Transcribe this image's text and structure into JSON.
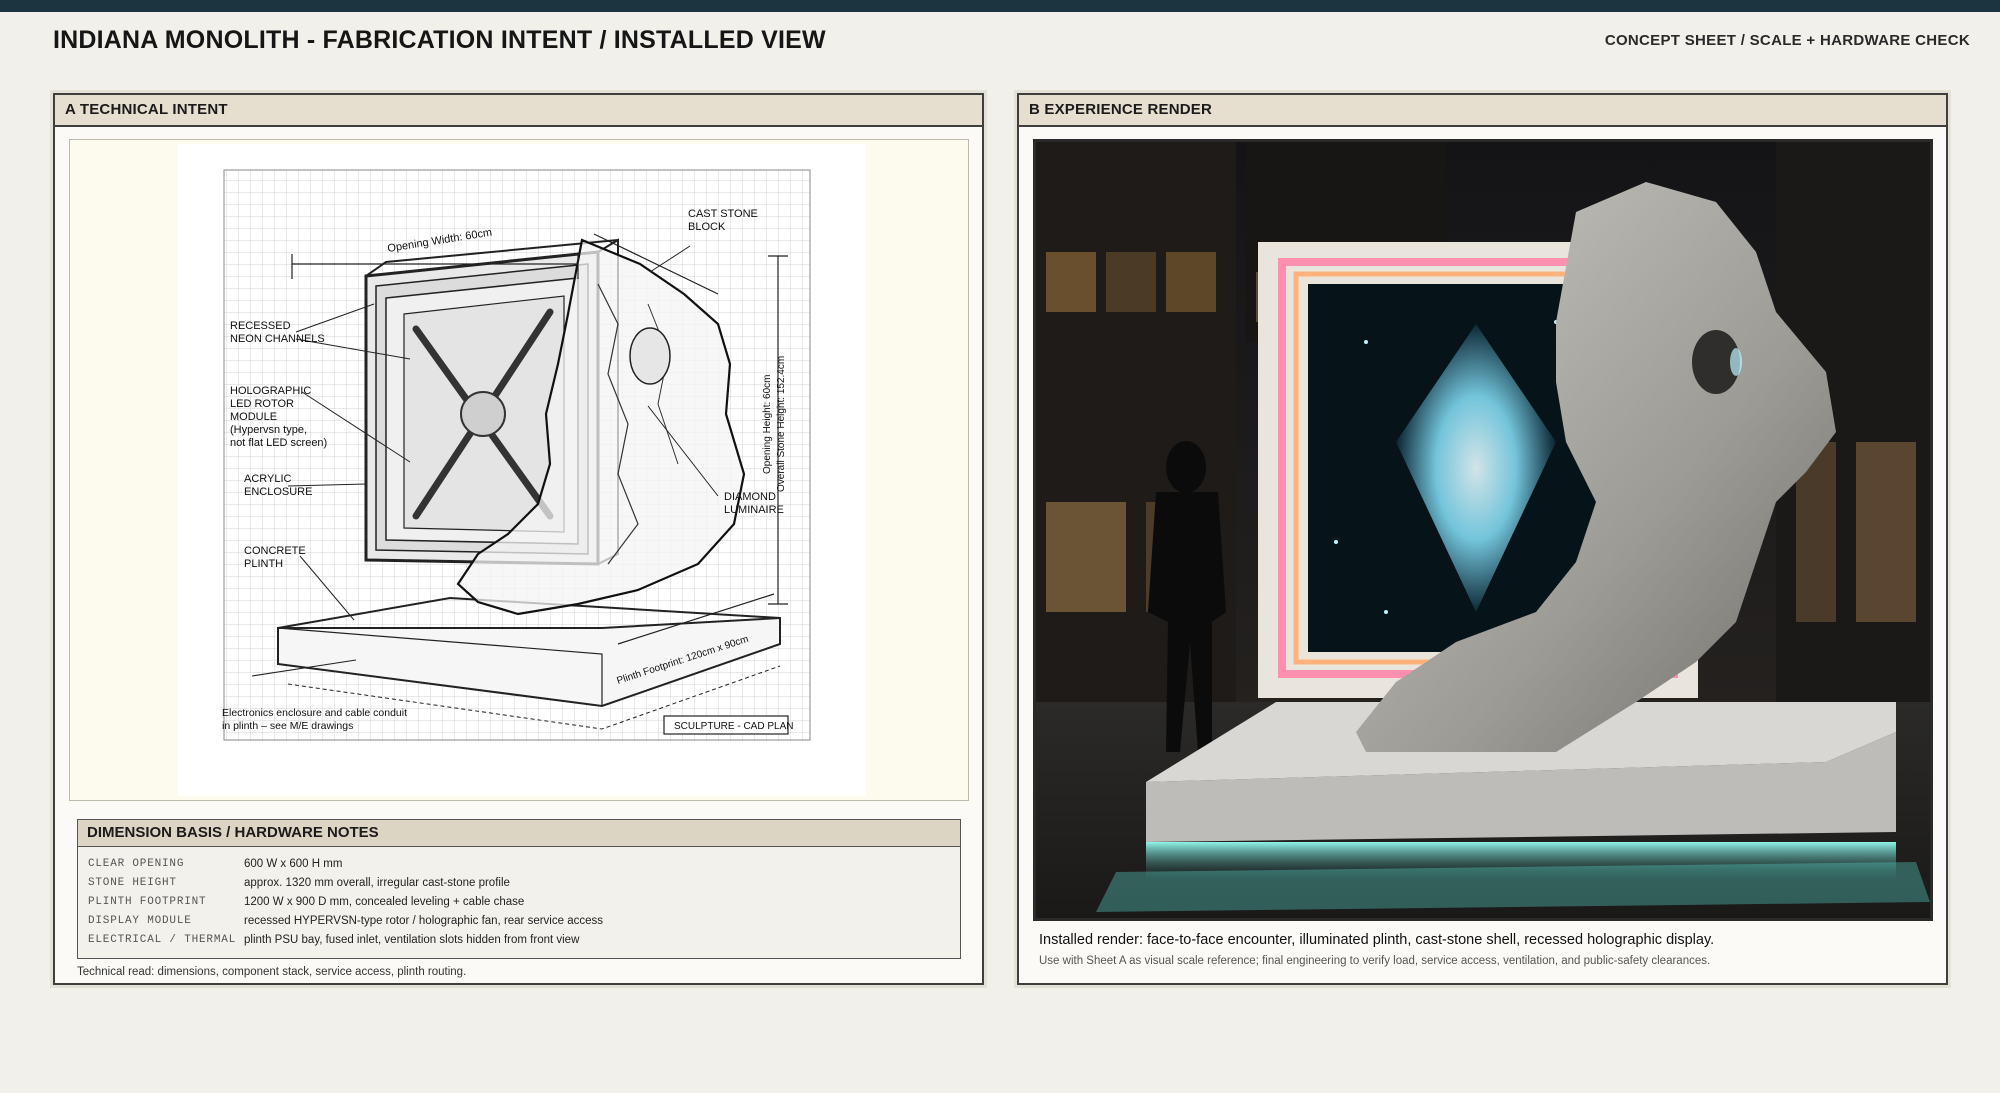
{
  "header": {
    "title": "INDIANA MONOLITH - FABRICATION INTENT / INSTALLED VIEW",
    "subtitle": "CONCEPT SHEET  /  SCALE + HARDWARE CHECK"
  },
  "panel_a": {
    "title": "A  TECHNICAL INTENT",
    "drawing": {
      "labels": {
        "opening_width": "Opening Width: 60cm",
        "cast_stone": [
          "CAST STONE",
          "BLOCK"
        ],
        "recessed_neon": [
          "RECESSED",
          "NEON CHANNELS"
        ],
        "holographic": [
          "HOLOGRAPHIC",
          "LED ROTOR",
          "MODULE",
          "(Hypervsn type,",
          "not flat LED screen)"
        ],
        "acrylic": [
          "ACRYLIC",
          "ENCLOSURE"
        ],
        "concrete": [
          "CONCRETE",
          "PLINTH"
        ],
        "opening_height": "Opening Height: 60cm",
        "stone_height": "Overall Stone Height: 152.4cm",
        "diamond": [
          "DIAMOND",
          "LUMINAIRE"
        ],
        "plinth_footprint": "Plinth Footprint: 120cm x 90cm",
        "electronics": [
          "Electronics enclosure and cable conduit",
          "in plinth – see M/E drawings"
        ],
        "title_block": "SCULPTURE - CAD PLAN"
      }
    },
    "notes": {
      "title": "DIMENSION BASIS / HARDWARE NOTES",
      "rows": [
        {
          "key": "CLEAR OPENING",
          "value": "600 W x 600 H mm"
        },
        {
          "key": "STONE HEIGHT",
          "value": "approx. 1320 mm overall, irregular cast-stone profile"
        },
        {
          "key": "PLINTH FOOTPRINT",
          "value": "1200 W x 900 D mm, concealed leveling + cable chase"
        },
        {
          "key": "DISPLAY MODULE",
          "value": "recessed HYPERVSN-type rotor / holographic fan, rear service access"
        },
        {
          "key": "ELECTRICAL / THERMAL",
          "value": "plinth PSU bay, fused inlet, ventilation slots hidden from front view"
        }
      ]
    },
    "caption": "Technical read: dimensions, component stack, service access, plinth routing."
  },
  "panel_b": {
    "title": "B  EXPERIENCE RENDER",
    "caption": "Installed render: face-to-face encounter, illuminated plinth, cast-stone shell, recessed holographic display.",
    "note": "Use with Sheet A as visual scale reference; final engineering to verify load, service access, ventilation, and public-safety clearances."
  },
  "colors": {
    "top_bar": "#1c3340",
    "panel_header": "#e6dfcf",
    "notes_header": "#ddd5c4",
    "plinth_glow": "#5fe0d4",
    "neon_pink": "#ff8fb0",
    "hologram": "#bdf3ff"
  }
}
